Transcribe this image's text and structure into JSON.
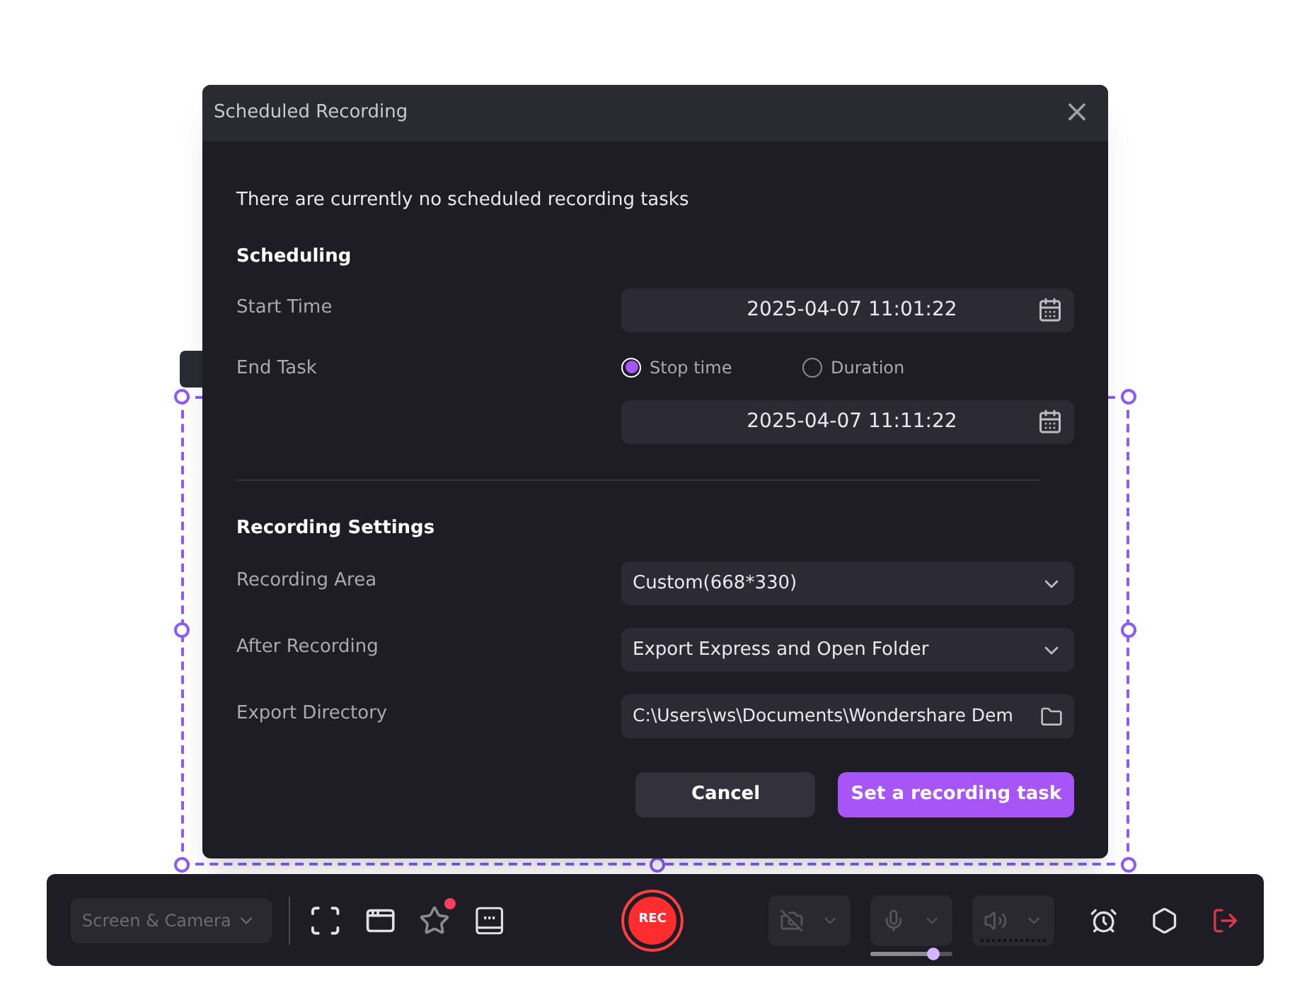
{
  "dialog": {
    "title": "Scheduled Recording",
    "close": "×",
    "message": "There are currently no scheduled recording tasks",
    "scheduling": {
      "heading": "Scheduling",
      "start_label": "Start Time",
      "start_value": "2025-04-07 11:01:22",
      "end_label": "End Task",
      "end_options": [
        {
          "label": "Stop time",
          "selected": true
        },
        {
          "label": "Duration",
          "selected": false
        }
      ],
      "end_value": "2025-04-07 11:11:22"
    },
    "settings": {
      "heading": "Recording Settings",
      "rows": [
        {
          "kind": "dropdown",
          "label": "Recording Area",
          "value": "Custom(668*330)"
        },
        {
          "kind": "dropdown",
          "label": "After Recording",
          "value": "Export Express and Open Folder"
        },
        {
          "kind": "folder",
          "label": "Export Directory",
          "value": "C:\\Users\\ws\\Documents\\Wondershare Dem"
        }
      ]
    },
    "buttons": [
      {
        "label": "Cancel",
        "kind": "secondary"
      },
      {
        "label": "Set a recording task",
        "kind": "primary"
      }
    ]
  },
  "toolbar": {
    "mode": {
      "label": "Screen & Camera",
      "disabled": true
    },
    "rec": "REC",
    "notification": true,
    "toggles": [
      {
        "kind": "camera",
        "disabled": true
      },
      {
        "kind": "microphone",
        "disabled": true
      },
      {
        "kind": "speaker",
        "disabled": true
      }
    ],
    "mic": {
      "level": 0.76
    }
  }
}
